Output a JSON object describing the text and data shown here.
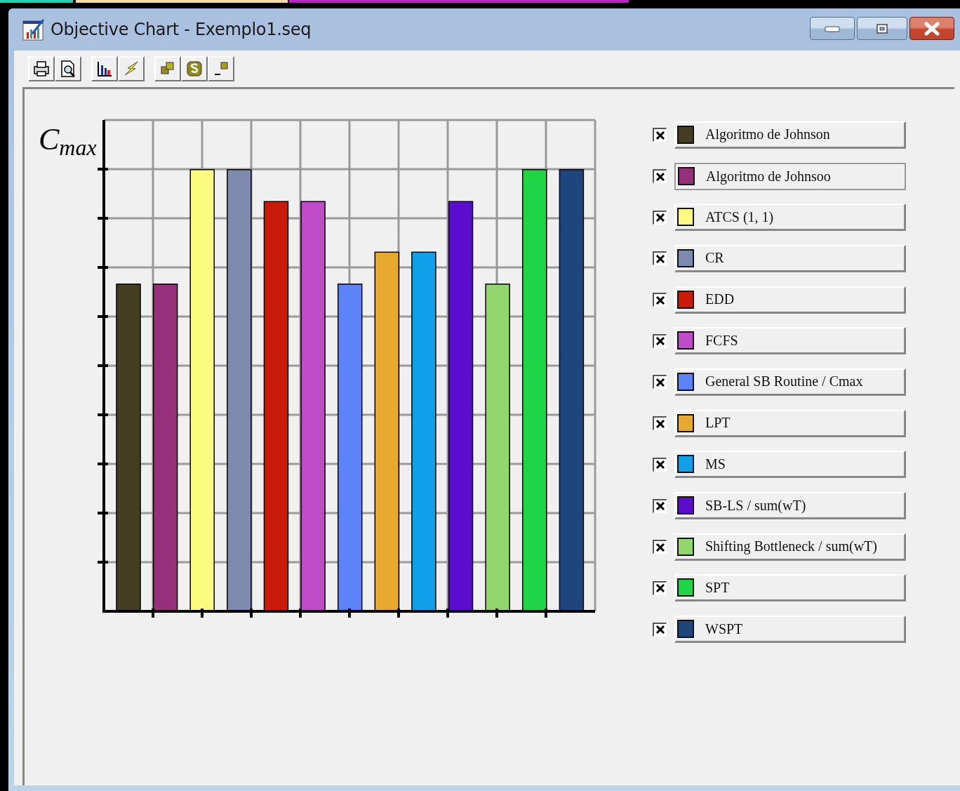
{
  "window": {
    "title": "Objective Chart - Exemplo1.seq"
  },
  "chart": {
    "ylabel": "C$_{max}$"
  },
  "legend": [
    {
      "label": "Algoritmo de Johnson",
      "color": "#433d22",
      "checked": true,
      "selected": false
    },
    {
      "label": "Algoritmo de Johnsoo",
      "color": "#96307a",
      "checked": true,
      "selected": true
    },
    {
      "label": "ATCS (1, 1)",
      "color": "#fbfb80",
      "checked": true,
      "selected": false
    },
    {
      "label": "CR",
      "color": "#7e8aad",
      "checked": true,
      "selected": false
    },
    {
      "label": "EDD",
      "color": "#c91a0a",
      "checked": true,
      "selected": false
    },
    {
      "label": "FCFS",
      "color": "#c04bc8",
      "checked": true,
      "selected": false
    },
    {
      "label": "General SB Routine / Cmax",
      "color": "#5c84f8",
      "checked": true,
      "selected": false
    },
    {
      "label": "LPT",
      "color": "#e8aa2e",
      "checked": true,
      "selected": false
    },
    {
      "label": "MS",
      "color": "#10a0ea",
      "checked": true,
      "selected": false
    },
    {
      "label": "SB-LS / sum(wT)",
      "color": "#5c0ccc",
      "checked": true,
      "selected": false
    },
    {
      "label": "Shifting Bottleneck / sum(wT)",
      "color": "#92d76e",
      "checked": true,
      "selected": false
    },
    {
      "label": "SPT",
      "color": "#1fd447",
      "checked": true,
      "selected": false
    },
    {
      "label": "WSPT",
      "color": "#1e457c",
      "checked": true,
      "selected": false
    }
  ]
}
